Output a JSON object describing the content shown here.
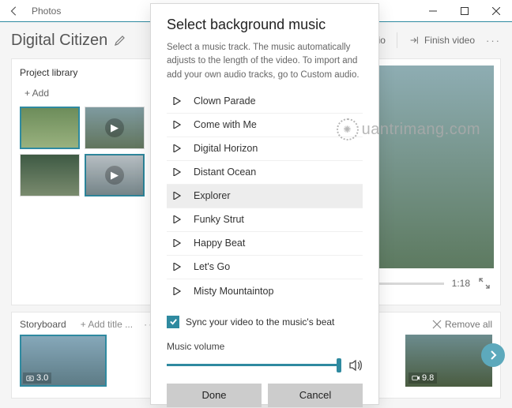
{
  "titlebar": {
    "app_name": "Photos"
  },
  "header": {
    "project_title": "Digital Citizen",
    "custom_audio_label": "om audio",
    "finish_video_label": "Finish video"
  },
  "library": {
    "title": "Project library",
    "add_label": "+  Add"
  },
  "preview": {
    "time_label": "1:18"
  },
  "storyboard": {
    "title": "Storyboard",
    "add_title_label": "+  Add title ...",
    "remove_all_label": "Remove all",
    "clips": [
      {
        "duration": "3.0"
      },
      {
        "duration": "9.8"
      }
    ]
  },
  "dialog": {
    "title": "Select background music",
    "description": "Select a music track. The music automatically adjusts to the length of the video. To import and add your own audio tracks, go to Custom audio.",
    "tracks": [
      "Clown Parade",
      "Come with Me",
      "Digital Horizon",
      "Distant Ocean",
      "Explorer",
      "Funky Strut",
      "Happy Beat",
      "Let's Go",
      "Misty Mountaintop"
    ],
    "selected_index": 4,
    "sync_label": "Sync your video to the music's beat",
    "volume_label": "Music volume",
    "done_label": "Done",
    "cancel_label": "Cancel"
  },
  "watermark": "uantrimang.com"
}
